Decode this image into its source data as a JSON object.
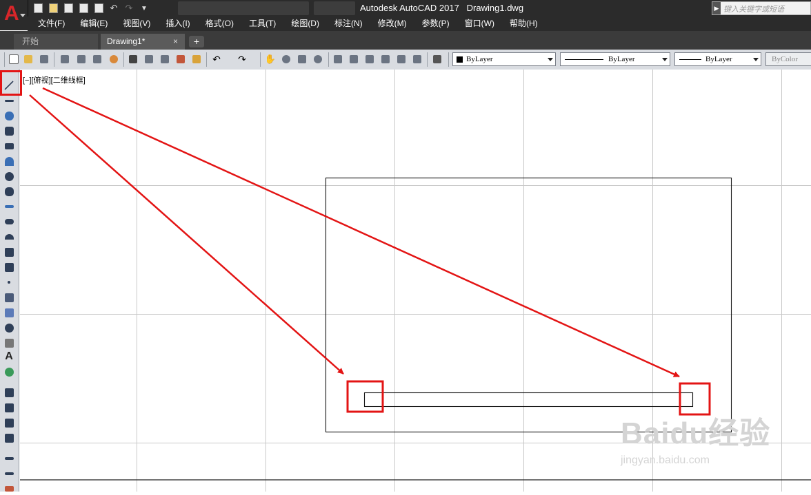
{
  "app": {
    "logo_letter": "A",
    "title": "Autodesk AutoCAD 2017",
    "document": "Drawing1.dwg"
  },
  "search": {
    "placeholder": "键入关键字或短语"
  },
  "quick_access": [
    "new-icon",
    "open-icon",
    "save-icon",
    "saveas-icon",
    "print-icon",
    "undo-icon",
    "redo-icon",
    "customize-icon"
  ],
  "menu": {
    "items": [
      "文件(F)",
      "编辑(E)",
      "视图(V)",
      "插入(I)",
      "格式(O)",
      "工具(T)",
      "绘图(D)",
      "标注(N)",
      "修改(M)",
      "参数(P)",
      "窗口(W)",
      "帮助(H)"
    ]
  },
  "tabs": {
    "start": "开始",
    "active": "Drawing1*",
    "close": "×",
    "add": "+"
  },
  "toolbar": {
    "color_value": "ByLayer",
    "linetype_value": "ByLayer",
    "lineweight_value": "ByLayer",
    "plotstyle_value": "ByColor"
  },
  "viewport": {
    "label": "[−][俯视][二维线框]"
  },
  "left_tools": [
    "line-icon",
    "construction-line-icon",
    "polyline-icon",
    "polygon-icon",
    "rectangle-icon",
    "arc-icon",
    "circle-icon",
    "revision-cloud-icon",
    "spline-icon",
    "ellipse-icon",
    "ellipse-arc-icon",
    "insert-block-icon",
    "make-block-icon",
    "point-icon",
    "hatch-icon",
    "gradient-icon",
    "region-icon",
    "table-icon",
    "multiline-text-icon",
    "add-selected-icon",
    "layer-properties-icon",
    "layer-previous-icon",
    "layer-isolate-icon",
    "layer-freeze-icon",
    "dimension-icon",
    "leader-icon",
    "tolerance-icon"
  ],
  "watermark": {
    "brand": "Baidu经验",
    "url": "jingyan.baidu.com"
  },
  "colors": {
    "dark_chrome": "#2b2b2b",
    "toolbar": "#d9dce1",
    "highlight": "#e31414",
    "grid": "#c8c8c8"
  }
}
